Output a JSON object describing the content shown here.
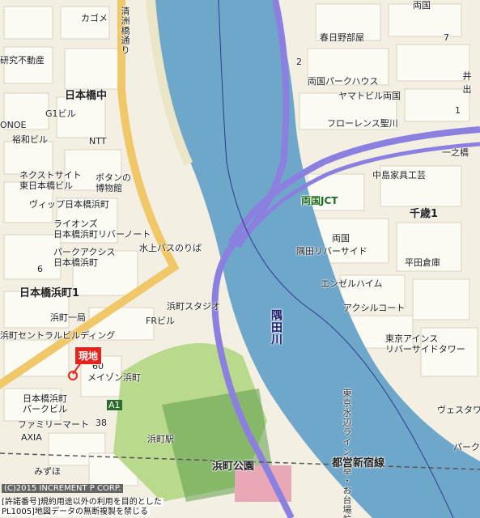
{
  "map": {
    "labels": {
      "kasen_road": "清洲橋通り",
      "kagoyoshi": "カゴメ",
      "nihonbashi_naka": "日本橋中",
      "kenkyu_fudosan": "研究不動産",
      "g1": "G1ビル",
      "onoe": "ONOE",
      "yuwa": "裕和ビル",
      "ntt": "NTT",
      "nexst": "ネクストサイト\n東日本橋ビル",
      "button_museum": "ボタンの\n博物館",
      "vita": "ヴィップ日本橋浜町",
      "lions": "ライオンズ\n日本橋浜町リバーノート",
      "park_axis": "パークアクシス\n日本橋浜町",
      "water_bus": "水上バスのりば",
      "nihonbashi_hamacho1": "日本橋浜町1",
      "hamacho_ichi": "浜町一局",
      "central_bldg": "浜町セントラルビルディング",
      "hamacho_studio": "浜町スタジオ",
      "fr_bldg": "FRビル",
      "maison": "メイゾン浜町",
      "nihonbashi_park": "日本橋浜町\nパークビル",
      "familymart": "ファミリーマート",
      "axia": "AXIA",
      "mizuho": "みずほ",
      "hamacho_station": "浜町駅",
      "hamacho_park": "浜町公園",
      "kasuganobeya": "春日野部屋",
      "ryogoku_park_house": "両国パークハウス",
      "yamato_bldg": "ヤマトビル両国",
      "florence": "フローレンス聖川",
      "ryogoku": "両国",
      "nakajima": "中島家具工芸",
      "ryogoku_jct": "両国JCT",
      "chitose1": "千歳1",
      "ryogoku2": "両国",
      "sumida_riverside": "隅田リバーサイド",
      "hirata": "平田倉庫",
      "entree_haim": "エンゼルハイム",
      "axial_court": "アクシルコート",
      "east_rivershine": "東京アインス\nリバーサイドタワー",
      "sumida_river": "隅田川",
      "shuto_line": "都営新宿線",
      "suijo_line": "東京水辺ライン浅草・お台場航路",
      "izumi": "井\n出",
      "kitaichi": "一之橋",
      "vertu": "ヴェスタワー",
      "park_label": "パーク",
      "num_6": "6",
      "num_7": "7",
      "num_2": "2",
      "num_1": "1",
      "num_60": "60",
      "num_38": "38",
      "a1": "A1",
      "koban_ryogoku": "両国"
    },
    "marker": "現地",
    "copyright": "(C)2015 INCREMENT P CORP.",
    "permit_line1": "[許諾番号]規約用途以外の利用を目的とした",
    "permit_line2": "PL1005]地図データの無断複製を禁じる",
    "colors": {
      "river": "#6ea7c9",
      "expressway": "#8b7fe0",
      "main_road": "#f0c869",
      "park": "#b9d98c",
      "land": "#f3efe2",
      "marker": "#e8231c"
    }
  }
}
